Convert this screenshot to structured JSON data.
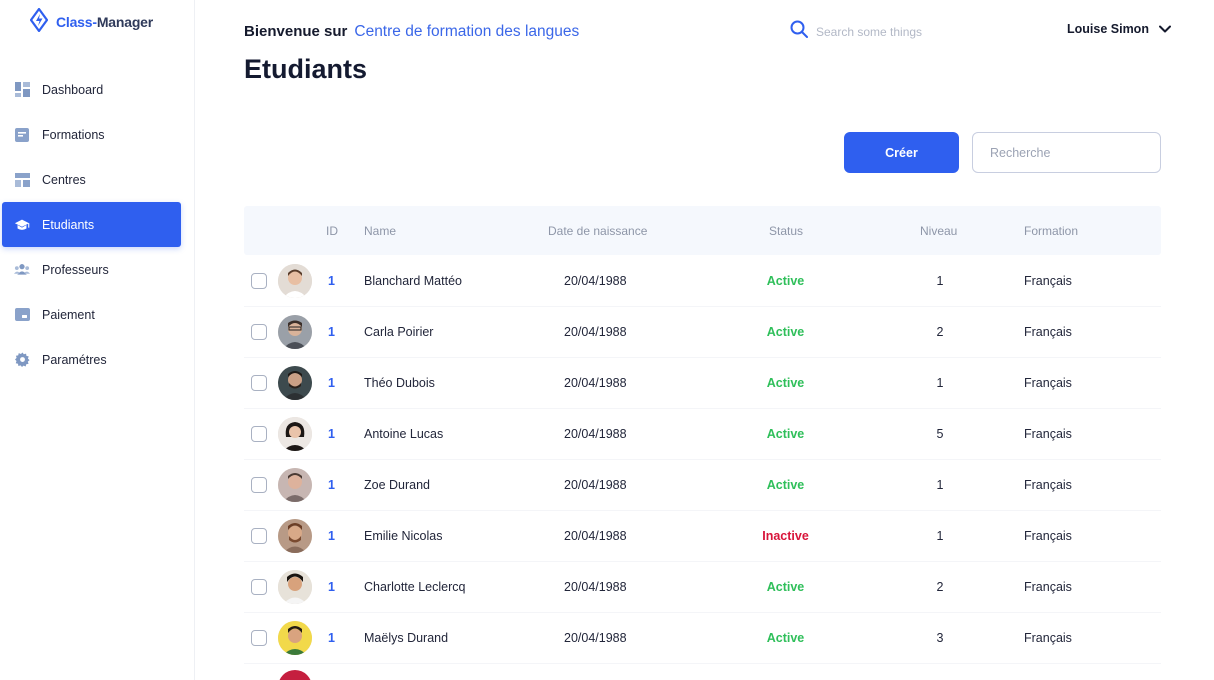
{
  "app": {
    "logo_prefix": "Class",
    "logo_suffix": "Manager",
    "brand_color": "#2f5fef"
  },
  "sidebar": {
    "items": [
      {
        "label": "Dashboard",
        "icon": "dashboard-icon",
        "active": false
      },
      {
        "label": "Formations",
        "icon": "formations-icon",
        "active": false
      },
      {
        "label": "Centres",
        "icon": "centres-icon",
        "active": false
      },
      {
        "label": "Etudiants",
        "icon": "graduation-cap-icon",
        "active": true
      },
      {
        "label": "Professeurs",
        "icon": "users-icon",
        "active": false
      },
      {
        "label": "Paiement",
        "icon": "payment-card-icon",
        "active": false
      },
      {
        "label": "Paramétres",
        "icon": "gear-icon",
        "active": false
      }
    ]
  },
  "header": {
    "welcome_lead": "Bienvenue sur",
    "center_name": "Centre de formation des langues",
    "search_placeholder": "Search some things",
    "user_name": "Louise Simon"
  },
  "main": {
    "title": "Etudiants",
    "create_label": "Créer",
    "search_placeholder": "Recherche"
  },
  "table": {
    "columns": {
      "id": "ID",
      "name": "Name",
      "date": "Date de naissance",
      "status": "Status",
      "niveau": "Niveau",
      "formation": "Formation"
    },
    "rows": [
      {
        "id": "1",
        "name": "Blanchard Mattéo",
        "date": "20/04/1988",
        "status": "Active",
        "niveau": "1",
        "formation": "Français"
      },
      {
        "id": "1",
        "name": "Carla Poirier",
        "date": "20/04/1988",
        "status": "Active",
        "niveau": "2",
        "formation": "Français"
      },
      {
        "id": "1",
        "name": "Théo Dubois",
        "date": "20/04/1988",
        "status": "Active",
        "niveau": "1",
        "formation": "Français"
      },
      {
        "id": "1",
        "name": "Antoine Lucas",
        "date": "20/04/1988",
        "status": "Active",
        "niveau": "5",
        "formation": "Français"
      },
      {
        "id": "1",
        "name": "Zoe Durand",
        "date": "20/04/1988",
        "status": "Active",
        "niveau": "1",
        "formation": "Français"
      },
      {
        "id": "1",
        "name": "Emilie Nicolas",
        "date": "20/04/1988",
        "status": "Inactive",
        "niveau": "1",
        "formation": "Français"
      },
      {
        "id": "1",
        "name": "Charlotte Leclercq",
        "date": "20/04/1988",
        "status": "Active",
        "niveau": "2",
        "formation": "Français"
      },
      {
        "id": "1",
        "name": "Maëlys Durand",
        "date": "20/04/1988",
        "status": "Active",
        "niveau": "3",
        "formation": "Français"
      }
    ]
  },
  "colors": {
    "accent": "#2f5fef",
    "active_status": "#2fbf5a",
    "inactive_status": "#d8143a"
  }
}
